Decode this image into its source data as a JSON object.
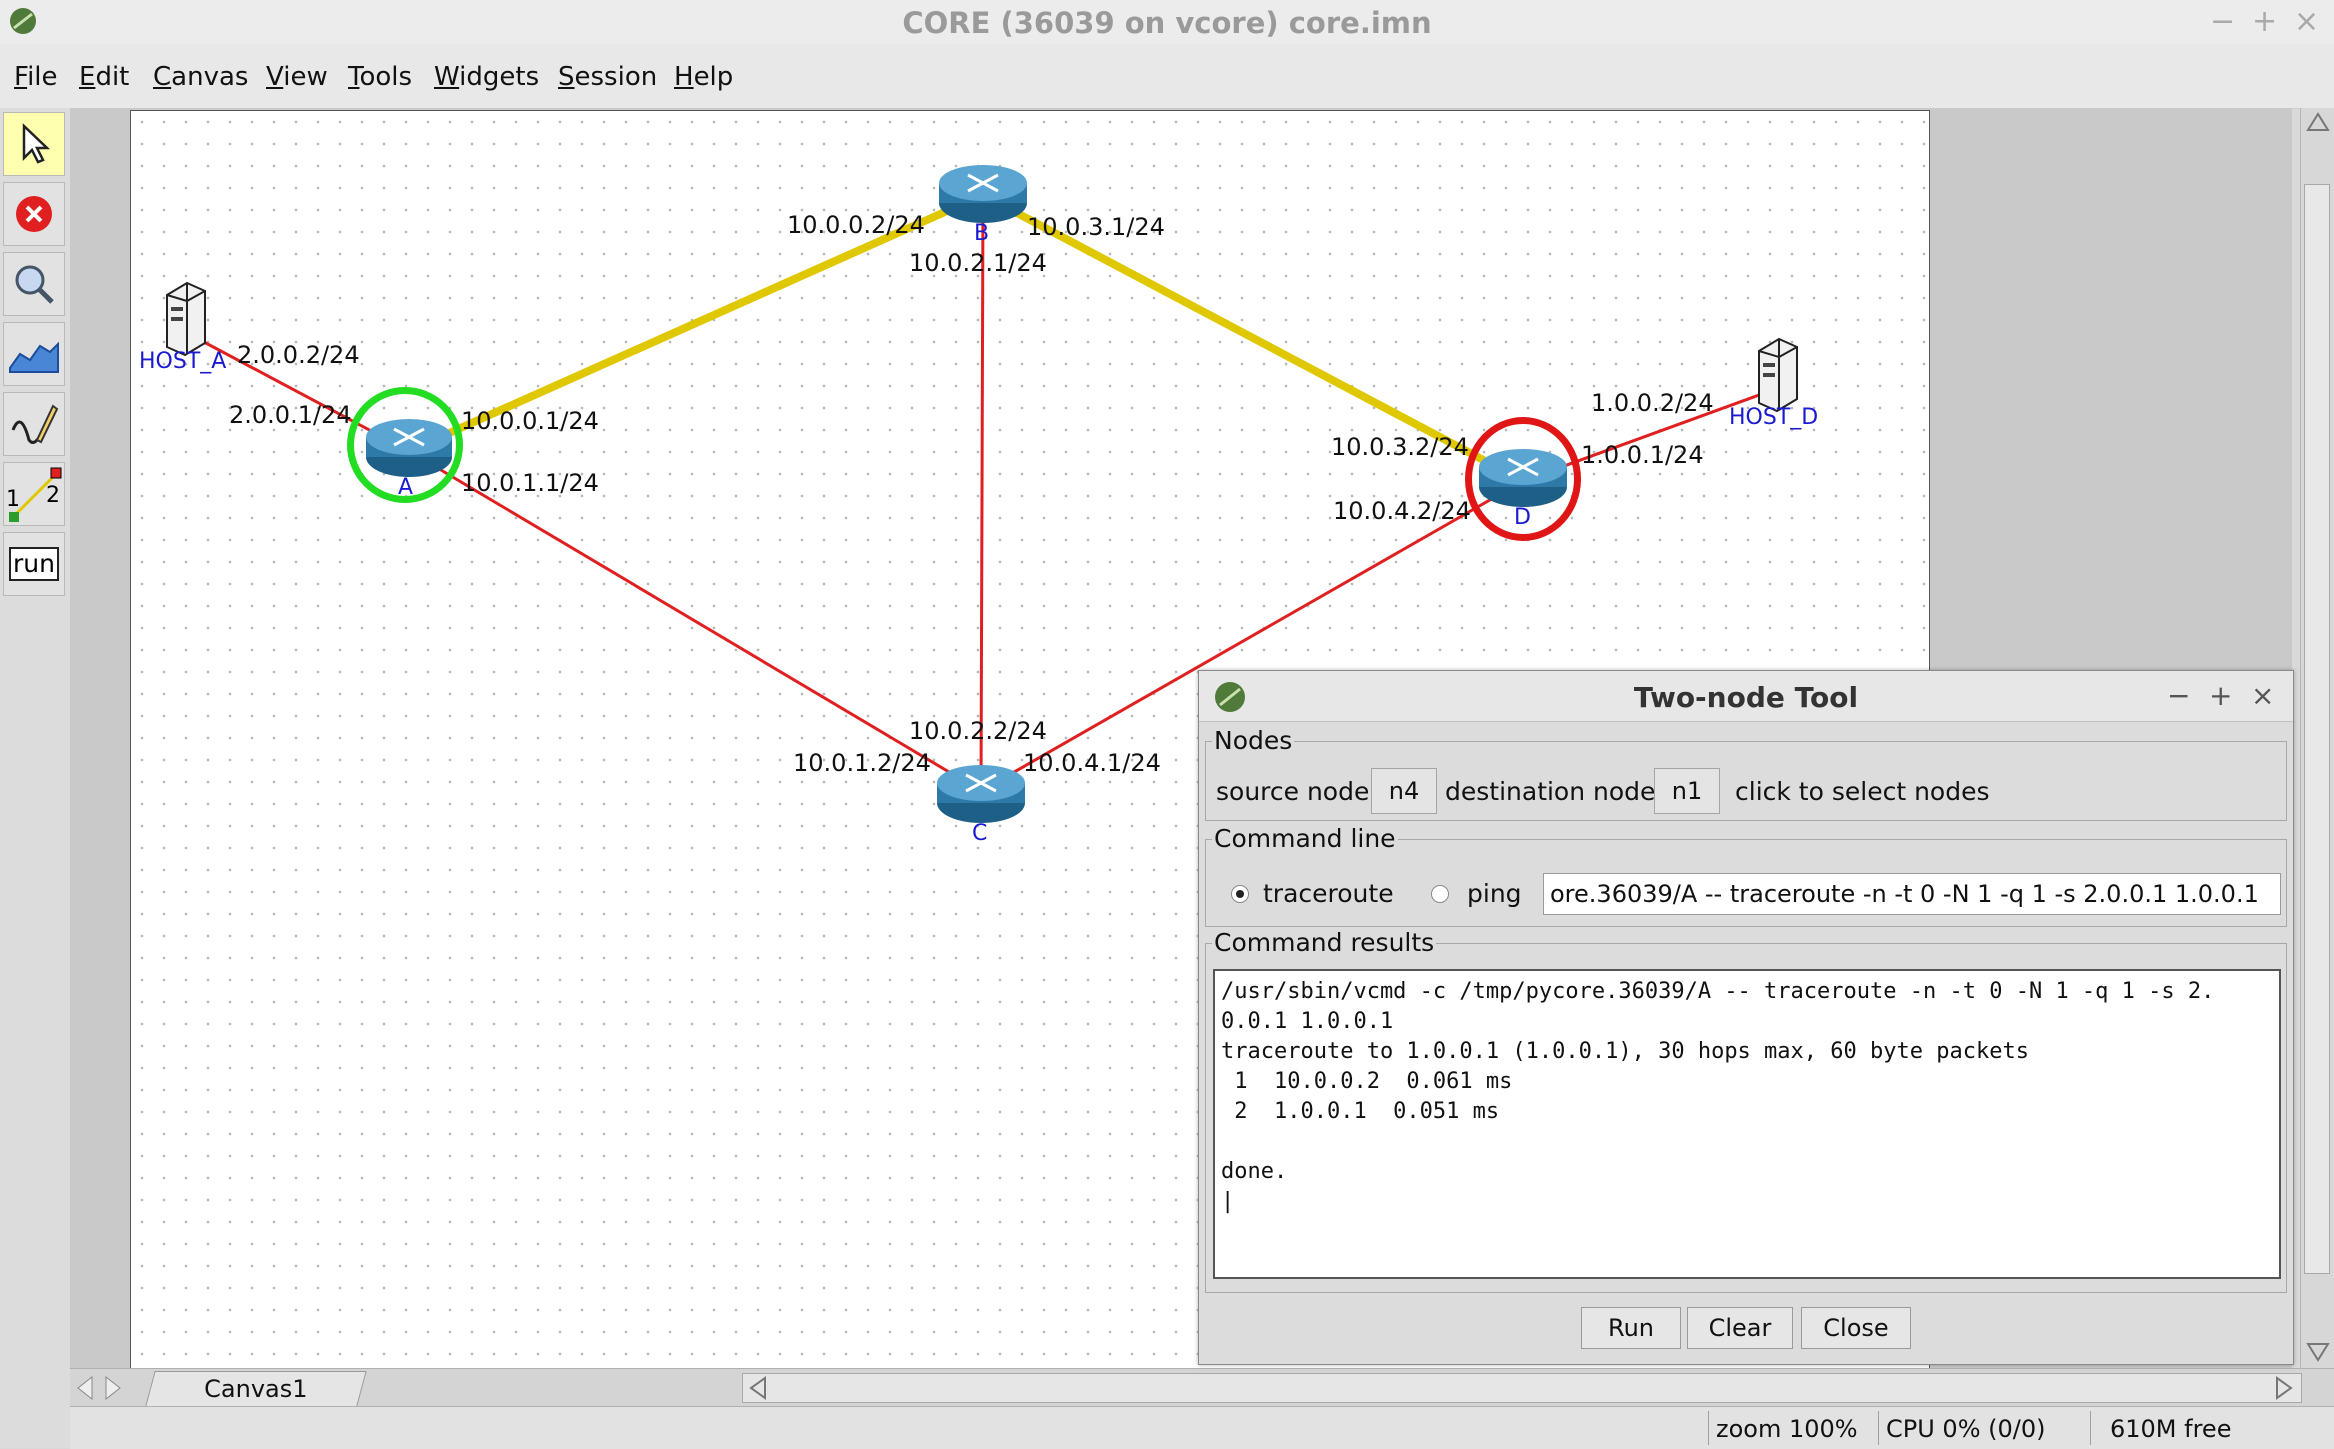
{
  "window": {
    "title": "CORE (36039 on vcore) core.imn",
    "controls": [
      "−",
      "+",
      "×"
    ]
  },
  "menu": [
    {
      "first": "F",
      "rest": "ile"
    },
    {
      "first": "E",
      "rest": "dit"
    },
    {
      "first": "C",
      "rest": "anvas"
    },
    {
      "first": "V",
      "rest": "iew"
    },
    {
      "first": "T",
      "rest": "ools"
    },
    {
      "first": "W",
      "rest": "idgets"
    },
    {
      "first": "S",
      "rest": "ession"
    },
    {
      "first": "H",
      "rest": "elp"
    }
  ],
  "toolbar": {
    "tools": [
      "select-arrow-icon",
      "stop-icon",
      "zoom-icon",
      "plot-icon",
      "draw-icon",
      "two-node-icon",
      "run-icon"
    ],
    "two_node_a": "1",
    "two_node_b": "2",
    "run_label": "run"
  },
  "nodes": {
    "A": "A",
    "B": "B",
    "C": "C",
    "D": "D",
    "host_a": "HOST_A",
    "host_d": "HOST_D"
  },
  "links": {
    "hostA_a": "2.0.0.2/24",
    "hostA_b": "2.0.0.1/24",
    "AB_a": "10.0.0.1/24",
    "AB_b": "10.0.0.2/24",
    "AC_a": "10.0.1.1/24",
    "AC_b": "10.0.1.2/24",
    "BC_a": "10.0.2.1/24",
    "BC_b": "10.0.2.2/24",
    "BD_a": "10.0.3.1/24",
    "BD_b": "10.0.3.2/24",
    "CD_a": "10.0.4.1/24",
    "CD_b": "10.0.4.2/24",
    "hostD_a": "1.0.0.2/24",
    "hostD_b": "1.0.0.1/24"
  },
  "colors": {
    "highlight_path": "#e0c800",
    "link": "#e02020",
    "source_ring": "#22dd22",
    "dest_ring": "#e01515",
    "node_label": "#1a1ad0"
  },
  "canvas_tab": "Canvas1",
  "status": {
    "zoom": "zoom 100%",
    "cpu": "CPU 0% (0/0)",
    "mem": "610M free"
  },
  "dialog": {
    "title": "Two-node Tool",
    "controls": [
      "−",
      "+",
      "×"
    ],
    "nodes_legend": "Nodes",
    "source_label": "source node",
    "source_value": "n4",
    "dest_label": "destination node",
    "dest_value": "n1",
    "hint": "click to select nodes",
    "cmdline_legend": "Command line",
    "opt_traceroute": "traceroute",
    "opt_ping": "ping",
    "selected": "traceroute",
    "command": "ore.36039/A -- traceroute -n -t 0 -N 1 -q 1 -s 2.0.0.1 1.0.0.1",
    "results_legend": "Command results",
    "results": "/usr/sbin/vcmd -c /tmp/pycore.36039/A -- traceroute -n -t 0 -N 1 -q 1 -s 2.\n0.0.1 1.0.0.1\ntraceroute to 1.0.0.1 (1.0.0.1), 30 hops max, 60 byte packets\n 1  10.0.0.2  0.061 ms\n 2  1.0.0.1  0.051 ms\n\ndone.\n|",
    "run": "Run",
    "clear": "Clear",
    "close": "Close"
  }
}
